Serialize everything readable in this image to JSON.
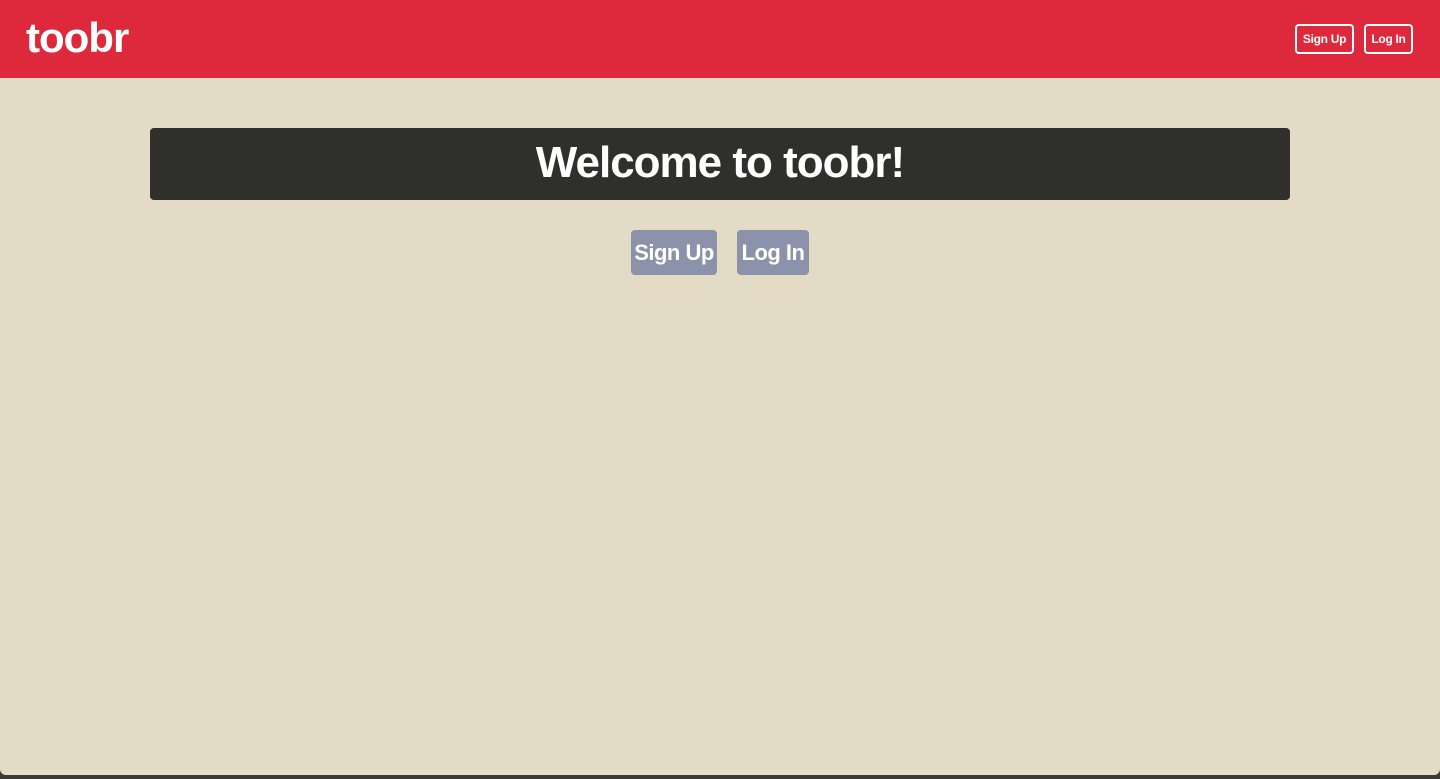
{
  "navbar": {
    "brand": "toobr",
    "signup_label": "Sign Up",
    "login_label": "Log In"
  },
  "hero": {
    "title": "Welcome to toobr!"
  },
  "actions": {
    "signup_label": "Sign Up",
    "login_label": "Log In"
  },
  "colors": {
    "navbar_bg": "#dd293b",
    "page_bg": "#e3dbc5",
    "hero_bg": "#2f2f2b",
    "button_bg": "#8a93a9"
  }
}
